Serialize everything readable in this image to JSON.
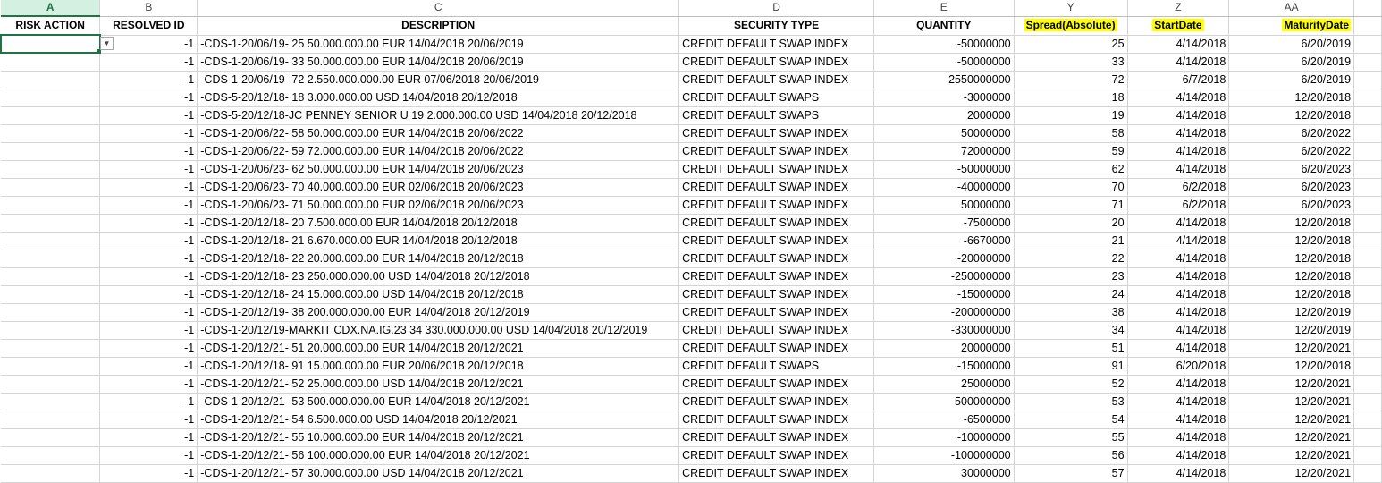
{
  "columns": {
    "letters": [
      "A",
      "B",
      "C",
      "D",
      "E",
      "Y",
      "Z",
      "AA"
    ],
    "headers": [
      "RISK ACTION",
      "RESOLVED ID",
      "DESCRIPTION",
      "SECURITY TYPE",
      "QUANTITY",
      "Spread(Absolute)",
      "StartDate",
      "MaturityDate"
    ],
    "highlighted_headers": [
      "Spread(Absolute)",
      "StartDate",
      "MaturityDate"
    ],
    "highlight_color": "#ffff00"
  },
  "selected_cell": "A2",
  "dropdown_icon": "chevron-down-icon",
  "rows": [
    {
      "risk_action": "",
      "resolved_id": "-1",
      "description": "-CDS-1-20/06/19- 25 50.000.000.00 EUR 14/04/2018 20/06/2019",
      "security_type": "CREDIT DEFAULT SWAP INDEX",
      "quantity": "-50000000",
      "spread": "25",
      "start_date": "4/14/2018",
      "maturity_date": "6/20/2019"
    },
    {
      "risk_action": "",
      "resolved_id": "-1",
      "description": "-CDS-1-20/06/19- 33 50.000.000.00 EUR 14/04/2018 20/06/2019",
      "security_type": "CREDIT DEFAULT SWAP INDEX",
      "quantity": "-50000000",
      "spread": "33",
      "start_date": "4/14/2018",
      "maturity_date": "6/20/2019"
    },
    {
      "risk_action": "",
      "resolved_id": "-1",
      "description": "-CDS-1-20/06/19- 72 2.550.000.000.00 EUR 07/06/2018 20/06/2019",
      "security_type": "CREDIT DEFAULT SWAP INDEX",
      "quantity": "-2550000000",
      "spread": "72",
      "start_date": "6/7/2018",
      "maturity_date": "6/20/2019"
    },
    {
      "risk_action": "",
      "resolved_id": "-1",
      "description": "-CDS-5-20/12/18- 18 3.000.000.00 USD 14/04/2018 20/12/2018",
      "security_type": "CREDIT DEFAULT SWAPS",
      "quantity": "-3000000",
      "spread": "18",
      "start_date": "4/14/2018",
      "maturity_date": "12/20/2018"
    },
    {
      "risk_action": "",
      "resolved_id": "-1",
      "description": "-CDS-5-20/12/18-JC PENNEY SENIOR U 19 2.000.000.00 USD 14/04/2018 20/12/2018",
      "security_type": "CREDIT DEFAULT SWAPS",
      "quantity": "2000000",
      "spread": "19",
      "start_date": "4/14/2018",
      "maturity_date": "12/20/2018"
    },
    {
      "risk_action": "",
      "resolved_id": "-1",
      "description": "-CDS-1-20/06/22- 58 50.000.000.00 EUR 14/04/2018 20/06/2022",
      "security_type": "CREDIT DEFAULT SWAP INDEX",
      "quantity": "50000000",
      "spread": "58",
      "start_date": "4/14/2018",
      "maturity_date": "6/20/2022"
    },
    {
      "risk_action": "",
      "resolved_id": "-1",
      "description": "-CDS-1-20/06/22- 59 72.000.000.00 EUR 14/04/2018 20/06/2022",
      "security_type": "CREDIT DEFAULT SWAP INDEX",
      "quantity": "72000000",
      "spread": "59",
      "start_date": "4/14/2018",
      "maturity_date": "6/20/2022"
    },
    {
      "risk_action": "",
      "resolved_id": "-1",
      "description": "-CDS-1-20/06/23- 62 50.000.000.00 EUR 14/04/2018 20/06/2023",
      "security_type": "CREDIT DEFAULT SWAP INDEX",
      "quantity": "-50000000",
      "spread": "62",
      "start_date": "4/14/2018",
      "maturity_date": "6/20/2023"
    },
    {
      "risk_action": "",
      "resolved_id": "-1",
      "description": "-CDS-1-20/06/23- 70 40.000.000.00 EUR 02/06/2018 20/06/2023",
      "security_type": "CREDIT DEFAULT SWAP INDEX",
      "quantity": "-40000000",
      "spread": "70",
      "start_date": "6/2/2018",
      "maturity_date": "6/20/2023"
    },
    {
      "risk_action": "",
      "resolved_id": "-1",
      "description": "-CDS-1-20/06/23- 71 50.000.000.00 EUR 02/06/2018 20/06/2023",
      "security_type": "CREDIT DEFAULT SWAP INDEX",
      "quantity": "50000000",
      "spread": "71",
      "start_date": "6/2/2018",
      "maturity_date": "6/20/2023"
    },
    {
      "risk_action": "",
      "resolved_id": "-1",
      "description": "-CDS-1-20/12/18- 20 7.500.000.00 EUR 14/04/2018 20/12/2018",
      "security_type": "CREDIT DEFAULT SWAP INDEX",
      "quantity": "-7500000",
      "spread": "20",
      "start_date": "4/14/2018",
      "maturity_date": "12/20/2018"
    },
    {
      "risk_action": "",
      "resolved_id": "-1",
      "description": "-CDS-1-20/12/18- 21 6.670.000.00 EUR 14/04/2018 20/12/2018",
      "security_type": "CREDIT DEFAULT SWAP INDEX",
      "quantity": "-6670000",
      "spread": "21",
      "start_date": "4/14/2018",
      "maturity_date": "12/20/2018"
    },
    {
      "risk_action": "",
      "resolved_id": "-1",
      "description": "-CDS-1-20/12/18- 22 20.000.000.00 EUR 14/04/2018 20/12/2018",
      "security_type": "CREDIT DEFAULT SWAP INDEX",
      "quantity": "-20000000",
      "spread": "22",
      "start_date": "4/14/2018",
      "maturity_date": "12/20/2018"
    },
    {
      "risk_action": "",
      "resolved_id": "-1",
      "description": "-CDS-1-20/12/18- 23 250.000.000.00 USD 14/04/2018 20/12/2018",
      "security_type": "CREDIT DEFAULT SWAP INDEX",
      "quantity": "-250000000",
      "spread": "23",
      "start_date": "4/14/2018",
      "maturity_date": "12/20/2018"
    },
    {
      "risk_action": "",
      "resolved_id": "-1",
      "description": "-CDS-1-20/12/18- 24 15.000.000.00 USD 14/04/2018 20/12/2018",
      "security_type": "CREDIT DEFAULT SWAP INDEX",
      "quantity": "-15000000",
      "spread": "24",
      "start_date": "4/14/2018",
      "maturity_date": "12/20/2018"
    },
    {
      "risk_action": "",
      "resolved_id": "-1",
      "description": "-CDS-1-20/12/19- 38 200.000.000.00 EUR 14/04/2018 20/12/2019",
      "security_type": "CREDIT DEFAULT SWAP INDEX",
      "quantity": "-200000000",
      "spread": "38",
      "start_date": "4/14/2018",
      "maturity_date": "12/20/2019"
    },
    {
      "risk_action": "",
      "resolved_id": "-1",
      "description": "-CDS-1-20/12/19-MARKIT CDX.NA.IG.23 34 330.000.000.00 USD 14/04/2018 20/12/2019",
      "security_type": "CREDIT DEFAULT SWAP INDEX",
      "quantity": "-330000000",
      "spread": "34",
      "start_date": "4/14/2018",
      "maturity_date": "12/20/2019"
    },
    {
      "risk_action": "",
      "resolved_id": "-1",
      "description": "-CDS-1-20/12/21- 51 20.000.000.00 EUR 14/04/2018 20/12/2021",
      "security_type": "CREDIT DEFAULT SWAP INDEX",
      "quantity": "20000000",
      "spread": "51",
      "start_date": "4/14/2018",
      "maturity_date": "12/20/2021"
    },
    {
      "risk_action": "",
      "resolved_id": "-1",
      "description": "-CDS-1-20/12/18- 91 15.000.000.00 EUR 20/06/2018 20/12/2018",
      "security_type": "CREDIT DEFAULT SWAPS",
      "quantity": "-15000000",
      "spread": "91",
      "start_date": "6/20/2018",
      "maturity_date": "12/20/2018"
    },
    {
      "risk_action": "",
      "resolved_id": "-1",
      "description": "-CDS-1-20/12/21- 52 25.000.000.00 USD 14/04/2018 20/12/2021",
      "security_type": "CREDIT DEFAULT SWAP INDEX",
      "quantity": "25000000",
      "spread": "52",
      "start_date": "4/14/2018",
      "maturity_date": "12/20/2021"
    },
    {
      "risk_action": "",
      "resolved_id": "-1",
      "description": "-CDS-1-20/12/21- 53 500.000.000.00 EUR 14/04/2018 20/12/2021",
      "security_type": "CREDIT DEFAULT SWAP INDEX",
      "quantity": "-500000000",
      "spread": "53",
      "start_date": "4/14/2018",
      "maturity_date": "12/20/2021"
    },
    {
      "risk_action": "",
      "resolved_id": "-1",
      "description": "-CDS-1-20/12/21- 54 6.500.000.00 USD 14/04/2018 20/12/2021",
      "security_type": "CREDIT DEFAULT SWAP INDEX",
      "quantity": "-6500000",
      "spread": "54",
      "start_date": "4/14/2018",
      "maturity_date": "12/20/2021"
    },
    {
      "risk_action": "",
      "resolved_id": "-1",
      "description": "-CDS-1-20/12/21- 55 10.000.000.00 EUR 14/04/2018 20/12/2021",
      "security_type": "CREDIT DEFAULT SWAP INDEX",
      "quantity": "-10000000",
      "spread": "55",
      "start_date": "4/14/2018",
      "maturity_date": "12/20/2021"
    },
    {
      "risk_action": "",
      "resolved_id": "-1",
      "description": "-CDS-1-20/12/21- 56 100.000.000.00 EUR 14/04/2018 20/12/2021",
      "security_type": "CREDIT DEFAULT SWAP INDEX",
      "quantity": "-100000000",
      "spread": "56",
      "start_date": "4/14/2018",
      "maturity_date": "12/20/2021"
    },
    {
      "risk_action": "",
      "resolved_id": "-1",
      "description": "-CDS-1-20/12/21- 57 30.000.000.00 USD 14/04/2018 20/12/2021",
      "security_type": "CREDIT DEFAULT SWAP INDEX",
      "quantity": "30000000",
      "spread": "57",
      "start_date": "4/14/2018",
      "maturity_date": "12/20/2021"
    }
  ]
}
